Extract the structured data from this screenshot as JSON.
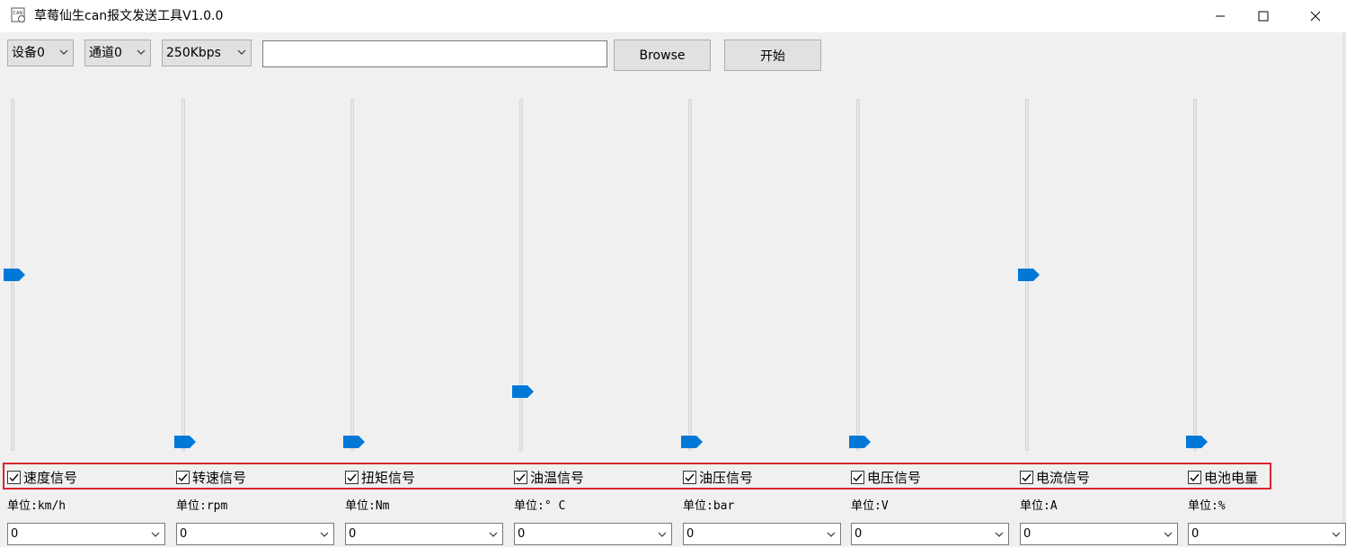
{
  "window": {
    "title": "草莓仙生can报文发送工具V1.0.0",
    "app_icon_label": "CAN"
  },
  "toolbar": {
    "device": "设备0",
    "channel": "通道0",
    "baudrate": "250Kbps",
    "file_path": "",
    "browse_label": "Browse",
    "start_label": "开始"
  },
  "colors": {
    "accent": "#0078d7",
    "highlight_frame": "#d8262b"
  },
  "signals": [
    {
      "label": "速度信号",
      "unit": "单位:km/h",
      "value": "0",
      "checked": true,
      "slider_level": 0.5
    },
    {
      "label": "转速信号",
      "unit": "单位:rpm",
      "value": "0",
      "checked": true,
      "slider_level": 0.0
    },
    {
      "label": "扭矩信号",
      "unit": "单位:Nm",
      "value": "0",
      "checked": true,
      "slider_level": 0.0
    },
    {
      "label": "油温信号",
      "unit": "单位:° C",
      "value": "0",
      "checked": true,
      "slider_level": 0.15
    },
    {
      "label": "油压信号",
      "unit": "单位:bar",
      "value": "0",
      "checked": true,
      "slider_level": 0.0
    },
    {
      "label": "电压信号",
      "unit": "单位:V",
      "value": "0",
      "checked": true,
      "slider_level": 0.0
    },
    {
      "label": "电流信号",
      "unit": "单位:A",
      "value": "0",
      "checked": true,
      "slider_level": 0.5
    },
    {
      "label": "电池电量",
      "unit": "单位:%",
      "value": "0",
      "checked": true,
      "slider_level": 0.0
    }
  ]
}
